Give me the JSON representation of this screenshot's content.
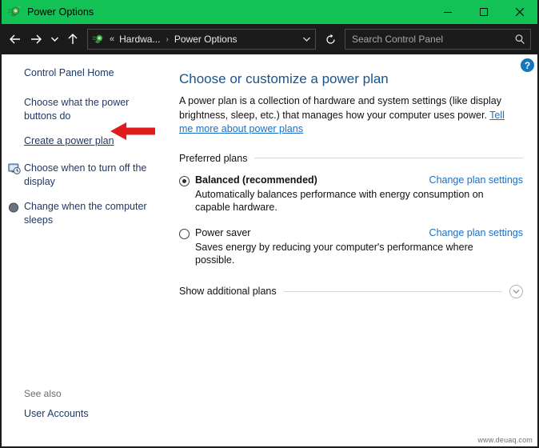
{
  "window": {
    "title": "Power Options",
    "title_icon": "power-plug-icon",
    "accent_color": "#12c254",
    "controls": [
      {
        "name": "minimize",
        "icon": "minimize-icon"
      },
      {
        "name": "maximize",
        "icon": "maximize-icon"
      },
      {
        "name": "close",
        "icon": "close-icon"
      }
    ]
  },
  "toolbar": {
    "back_icon": "back-arrow-icon",
    "forward_icon": "forward-arrow-icon",
    "recent_icon": "chevron-down-icon",
    "up_icon": "up-arrow-icon",
    "refresh_icon": "refresh-icon",
    "breadcrumb": {
      "icon": "power-plug-icon",
      "overflow": "«",
      "separator": "›",
      "items": [
        {
          "label": "Hardwa..."
        },
        {
          "label": "Power Options"
        }
      ],
      "dropdown_icon": "chevron-down-icon"
    },
    "search": {
      "placeholder": "Search Control Panel",
      "value": "",
      "icon": "search-icon"
    }
  },
  "sidebar": {
    "home_label": "Control Panel Home",
    "items": [
      {
        "label": "Choose what the power buttons do",
        "icon": "",
        "underlined": false
      },
      {
        "label": "Create a power plan",
        "icon": "",
        "underlined": true
      },
      {
        "label": "Choose when to turn off the display",
        "icon": "monitor-clock-icon",
        "underlined": false
      },
      {
        "label": "Change when the computer sleeps",
        "icon": "moon-sleep-icon",
        "underlined": false
      }
    ],
    "see_also": {
      "title": "See also",
      "links": [
        {
          "label": "User Accounts"
        }
      ]
    }
  },
  "main": {
    "help_label": "?",
    "title": "Choose or customize a power plan",
    "intro_text": "A power plan is a collection of hardware and system settings (like display brightness, sleep, etc.) that manages how your computer uses power. ",
    "intro_link": "Tell me more about power plans",
    "group_label": "Preferred plans",
    "plans": [
      {
        "name": "Balanced (recommended)",
        "selected": true,
        "bold": true,
        "description": "Automatically balances performance with energy consumption on capable hardware.",
        "action_label": "Change plan settings"
      },
      {
        "name": "Power saver",
        "selected": false,
        "bold": false,
        "description": "Saves energy by reducing your computer's performance where possible.",
        "action_label": "Change plan settings"
      }
    ],
    "additional": {
      "label": "Show additional plans",
      "icon": "chevron-down-circle-icon"
    }
  },
  "annotation": {
    "arrow_color": "#e01b1b",
    "arrow_direction": "left",
    "points_at": "Create a power plan"
  },
  "watermark": {
    "text": "www.deuaq.com"
  }
}
